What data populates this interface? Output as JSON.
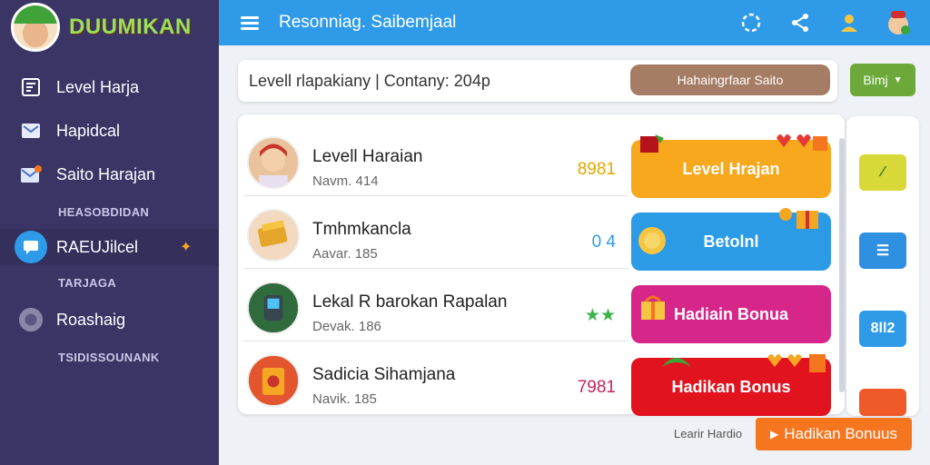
{
  "sidebar": {
    "brand": "DUUMIKAN",
    "items": [
      {
        "label": "Level Harja",
        "icon": "document-icon"
      },
      {
        "label": "Hapidcal",
        "icon": "mail-icon"
      },
      {
        "label": "Saito Harajan",
        "icon": "envelope-icon"
      }
    ],
    "section1": "HEASOBDIDAN",
    "active_item": {
      "label": "RAEUJilcel",
      "icon": "chat-icon"
    },
    "section2": "TARJAGA",
    "item_extra": {
      "label": "Roashaig",
      "icon": "circle-icon"
    },
    "section3": "TSIDISSOUNANK"
  },
  "topbar": {
    "title": "Resonniag. Saibemjaal"
  },
  "search": {
    "text": "Levell rlapakiany | Contany: 204p",
    "pill": "Hahaingrfaar Saito",
    "filter": "Bimj"
  },
  "rows": [
    {
      "title": "Levell Haraian",
      "sub": "Navm. 414",
      "score": "8981",
      "score_color": "#e0a800",
      "button": "Level Hrajan",
      "button_color": "#f7a81d"
    },
    {
      "title": "Tmhmkancla",
      "sub": "Aavar. 185",
      "score": "0 4",
      "score_color": "#2f9be8",
      "button": "Betolnl",
      "button_color": "#2b9be6"
    },
    {
      "title": "Lekal R barokan Rapalan",
      "sub": "Devak. 186",
      "score": "★★",
      "score_color": "#3bb34a",
      "button": "Hadiain Bonua",
      "button_color": "#d6268a"
    },
    {
      "title": "Sadicia Sihamjana",
      "sub": "Navik. 185",
      "score": "7981",
      "score_color": "#c8235a",
      "button": "Hadikan Bonus",
      "button_color": "#e0131f"
    }
  ],
  "rail": {
    "items": [
      {
        "label": "⁄",
        "color": "#d8d838"
      },
      {
        "label": "☰",
        "color": "#2f8fe0"
      },
      {
        "label": "8ll2",
        "color": "#2f9be8"
      },
      {
        "label": "",
        "color": "#f05a28"
      }
    ]
  },
  "footer": {
    "text": "Learir Hardio",
    "button": "Hadikan Bonuus"
  },
  "colors": {
    "sidebar": "#3b3566",
    "topbar": "#2f9be8",
    "accent_orange": "#f5761f"
  }
}
